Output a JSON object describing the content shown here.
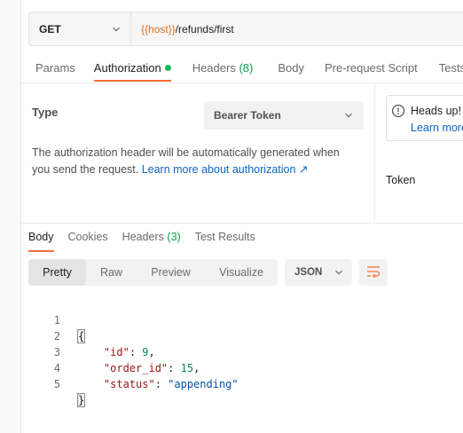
{
  "request": {
    "method": "GET",
    "url_variable": "{{host}}",
    "url_path": "/refunds/first"
  },
  "request_tabs": [
    {
      "label": "Params"
    },
    {
      "label": "Authorization"
    },
    {
      "label": "Headers ",
      "count": "(8)"
    },
    {
      "label": "Body"
    },
    {
      "label": "Pre-request Script"
    },
    {
      "label": "Tests"
    }
  ],
  "auth": {
    "type_label": "Type",
    "type_value": "Bearer Token",
    "description": "The authorization header will be automatically generated when you send the request. ",
    "learn_more": "Learn more about authorization ↗",
    "heads_up_title": "Heads up!",
    "heads_up_link": "Learn more",
    "token_label": "Token"
  },
  "response_tabs": [
    {
      "label": "Body"
    },
    {
      "label": "Cookies"
    },
    {
      "label": "Headers ",
      "count": "(3)"
    },
    {
      "label": "Test Results"
    }
  ],
  "view_modes": [
    "Pretty",
    "Raw",
    "Preview",
    "Visualize"
  ],
  "format": "JSON",
  "colors": {
    "accent": "#ff6c37",
    "status_green": "#0cbb52",
    "link": "#0e65c0",
    "url_variable": "#e26d1b"
  },
  "icons": {
    "chevron": "chevron-down-icon",
    "info": "info-icon",
    "wrap": "wrap-lines-icon"
  },
  "code": {
    "line_numbers": [
      "1",
      "2",
      "3",
      "4",
      "5"
    ],
    "open_brace": "{",
    "close_brace": "}",
    "fields": [
      {
        "key": "\"id\"",
        "value": "9",
        "kind": "number",
        "trail": ","
      },
      {
        "key": "\"order_id\"",
        "value": "15",
        "kind": "number",
        "trail": ","
      },
      {
        "key": "\"status\"",
        "value": "\"appending\"",
        "kind": "string",
        "trail": ""
      }
    ]
  }
}
